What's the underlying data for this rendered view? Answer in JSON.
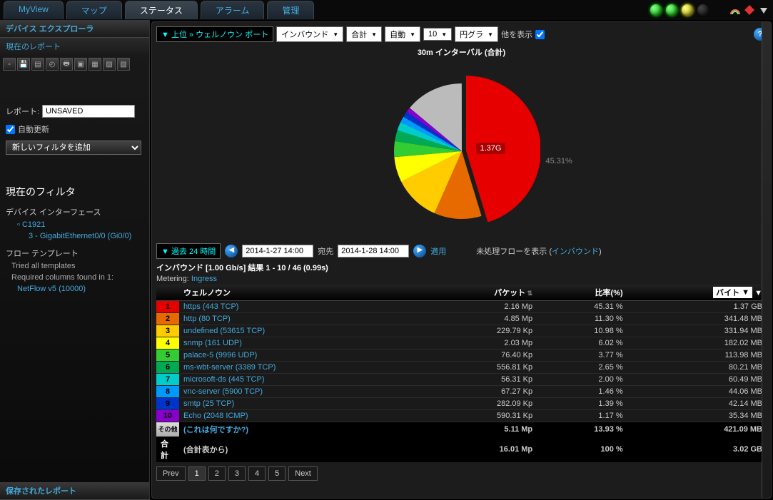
{
  "tabs": [
    "MyView",
    "マップ",
    "ステータス",
    "アラーム",
    "管理"
  ],
  "active_tab": 2,
  "sidebar": {
    "explorer_title": "デバイス エクスプローラ",
    "current_report": "現在のレポート",
    "report_label": "レポート:",
    "report_value": "UNSAVED",
    "auto_update": "自動更新",
    "add_filter": "新しいフィルタを追加",
    "current_filter": "現在のフィルタ",
    "device_iface": "デバイス インターフェース",
    "device": "C1921",
    "iface": "3 - GigabitEthernet0/0 (Gi0/0)",
    "flow_template": "フロー テンプレート",
    "tried": "Tried all templates",
    "req_cols": "Required columns found in 1:",
    "netflow": "NetFlow v5 (10000)",
    "saved": "保存されたレポート"
  },
  "controls": {
    "top": "▼ 上位 » ウェルノウン ポート",
    "direction": "インバウンド",
    "agg": "合計",
    "auto": "自動",
    "count": "10",
    "chart_type": "円グラ",
    "show_other": "他を表示"
  },
  "chart": {
    "title": "30m インターバル (合計)",
    "big_label": "1.37G",
    "big_pct": "45.31%"
  },
  "chart_data": {
    "type": "pie",
    "title": "30m インターバル (合計)",
    "series": [
      {
        "name": "https (443 TCP)",
        "pct": 45.31,
        "color": "#e60000"
      },
      {
        "name": "http (80 TCP)",
        "pct": 11.3,
        "color": "#e66a00"
      },
      {
        "name": "undefined (53615 TCP)",
        "pct": 10.98,
        "color": "#ffcc00"
      },
      {
        "name": "snmp (161 UDP)",
        "pct": 6.02,
        "color": "#ffff00"
      },
      {
        "name": "palace-5 (9996 UDP)",
        "pct": 3.77,
        "color": "#33cc33"
      },
      {
        "name": "ms-wbt-server (3389 TCP)",
        "pct": 2.65,
        "color": "#00aa55"
      },
      {
        "name": "microsoft-ds (445 TCP)",
        "pct": 2.0,
        "color": "#00cccc"
      },
      {
        "name": "vnc-server (5900 TCP)",
        "pct": 1.46,
        "color": "#0099ff"
      },
      {
        "name": "smtp (25 TCP)",
        "pct": 1.39,
        "color": "#0033cc"
      },
      {
        "name": "Echo (2048 ICMP)",
        "pct": 1.17,
        "color": "#8800cc"
      },
      {
        "name": "その他",
        "pct": 13.93,
        "color": "#bbbbbb"
      }
    ]
  },
  "time": {
    "range": "▼ 過去 24 時間",
    "from": "2014-1-27 14:00",
    "to_label": "宛先",
    "to": "2014-1-28 14:00",
    "apply": "適用",
    "raw_label": "未処理フローを表示 (",
    "raw_link": "インバウンド",
    "raw_close": ")"
  },
  "results": {
    "header": "インバウンド [1.00 Gb/s] 結果 1 - 10 / 46 (0.99s)",
    "metering_label": "Metering:",
    "metering": "Ingress"
  },
  "columns": {
    "port": "ウェルノウン",
    "packets": "パケット",
    "pct": "比率(%)",
    "unit": "バイト"
  },
  "rows": [
    {
      "n": "1",
      "c": "#e60000",
      "name": "https (443 TCP)",
      "pk": "2.16 Mp",
      "pct": "45.31 %",
      "b": "1.37 GB"
    },
    {
      "n": "2",
      "c": "#e66a00",
      "name": "http (80 TCP)",
      "pk": "4.85 Mp",
      "pct": "11.30 %",
      "b": "341.48 MB"
    },
    {
      "n": "3",
      "c": "#ffcc00",
      "name": "undefined (53615 TCP)",
      "pk": "229.79 Kp",
      "pct": "10.98 %",
      "b": "331.94 MB"
    },
    {
      "n": "4",
      "c": "#ffff00",
      "name": "snmp (161 UDP)",
      "pk": "2.03 Mp",
      "pct": "6.02 %",
      "b": "182.02 MB"
    },
    {
      "n": "5",
      "c": "#33cc33",
      "name": "palace-5 (9996 UDP)",
      "pk": "76.40 Kp",
      "pct": "3.77 %",
      "b": "113.98 MB"
    },
    {
      "n": "6",
      "c": "#00aa55",
      "name": "ms-wbt-server (3389 TCP)",
      "pk": "556.81 Kp",
      "pct": "2.65 %",
      "b": "80.21 MB"
    },
    {
      "n": "7",
      "c": "#00cccc",
      "name": "microsoft-ds (445 TCP)",
      "pk": "56.31 Kp",
      "pct": "2.00 %",
      "b": "60.49 MB"
    },
    {
      "n": "8",
      "c": "#0099ff",
      "name": "vnc-server (5900 TCP)",
      "pk": "67.27 Kp",
      "pct": "1.46 %",
      "b": "44.06 MB"
    },
    {
      "n": "9",
      "c": "#0033cc",
      "name": "smtp (25 TCP)",
      "pk": "282.09 Kp",
      "pct": "1.39 %",
      "b": "42.14 MB"
    },
    {
      "n": "10",
      "c": "#8800cc",
      "name": "Echo (2048 ICMP)",
      "pk": "590.31 Kp",
      "pct": "1.17 %",
      "b": "35.34 MB"
    }
  ],
  "other": {
    "label": "その他",
    "q": "(これは何ですか?)",
    "pk": "5.11 Mp",
    "pct": "13.93 %",
    "b": "421.09 MB"
  },
  "total": {
    "label": "合計",
    "from": "(合計表から)",
    "pk": "16.01 Mp",
    "pct": "100 %",
    "b": "3.02 GB"
  },
  "pager": {
    "prev": "Prev",
    "pages": [
      "1",
      "2",
      "3",
      "4",
      "5"
    ],
    "next": "Next"
  }
}
